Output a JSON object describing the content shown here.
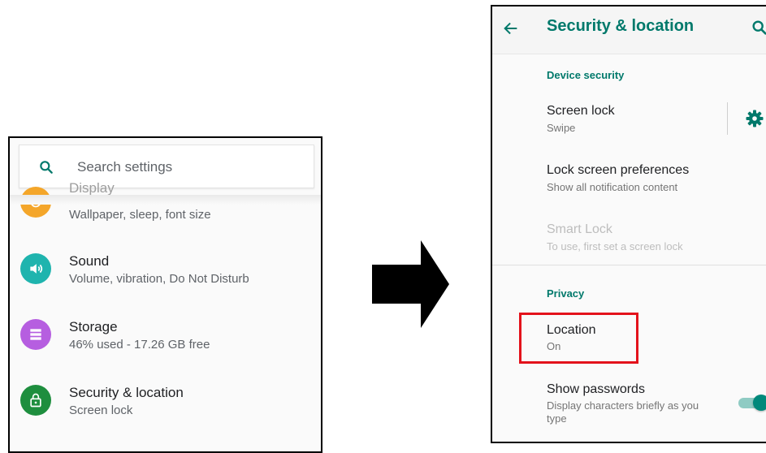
{
  "left": {
    "search_placeholder": "Search settings",
    "rows": [
      {
        "title": "Display",
        "subtitle": "Wallpaper, sleep, font size",
        "icon": "display-icon",
        "color": "#f4a62a"
      },
      {
        "title": "Sound",
        "subtitle": "Volume, vibration, Do Not Disturb",
        "icon": "sound-icon",
        "color": "#1fb4ae"
      },
      {
        "title": "Storage",
        "subtitle": "46% used - 17.26 GB free",
        "icon": "storage-icon",
        "color": "#b65ee0"
      },
      {
        "title": "Security & location",
        "subtitle": "Screen lock",
        "icon": "lock-icon",
        "color": "#1e8e3e"
      }
    ]
  },
  "right": {
    "app_bar_title": "Security & location",
    "device_security_header": "Device security",
    "screen_lock": {
      "title": "Screen lock",
      "subtitle": "Swipe"
    },
    "lock_screen_prefs": {
      "title": "Lock screen preferences",
      "subtitle": "Show all notification content"
    },
    "smart_lock": {
      "title": "Smart Lock",
      "subtitle": "To use, first set a screen lock"
    },
    "privacy_header": "Privacy",
    "location": {
      "title": "Location",
      "subtitle": "On"
    },
    "show_passwords": {
      "title": "Show passwords",
      "subtitle": "Display characters briefly as you type",
      "enabled": true
    }
  },
  "colors": {
    "accent": "#00796b",
    "highlight": "#e3121b"
  }
}
